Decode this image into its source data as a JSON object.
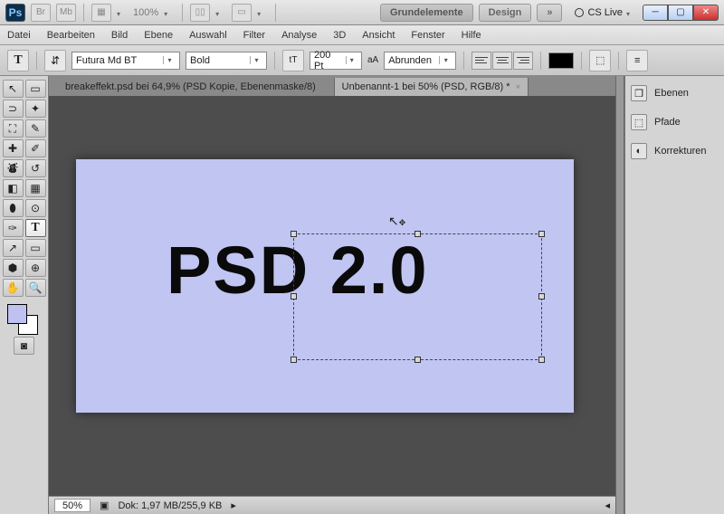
{
  "topbar": {
    "percent": "100%",
    "workspace_active": "Grundelemente",
    "workspace_other": "Design",
    "cslive": "CS Live"
  },
  "menu": [
    "Datei",
    "Bearbeiten",
    "Bild",
    "Ebene",
    "Auswahl",
    "Filter",
    "Analyse",
    "3D",
    "Ansicht",
    "Fenster",
    "Hilfe"
  ],
  "options": {
    "font": "Futura Md BT",
    "weight": "Bold",
    "size": "200 Pt",
    "aa_label": "aA",
    "aa_value": "Abrunden"
  },
  "tabs": [
    {
      "label": "breakeffekt.psd bei 64,9% (PSD Kopie, Ebenenmaske/8)",
      "active": false
    },
    {
      "label": "Unbenannt-1 bei 50% (PSD, RGB/8) *",
      "active": true
    }
  ],
  "canvas": {
    "text": "PSD 2.0"
  },
  "status": {
    "zoom": "50%",
    "doc": "Dok: 1,97 MB/255,9 KB"
  },
  "panels": {
    "ebenen": "Ebenen",
    "pfade": "Pfade",
    "korrekturen": "Korrekturen"
  }
}
